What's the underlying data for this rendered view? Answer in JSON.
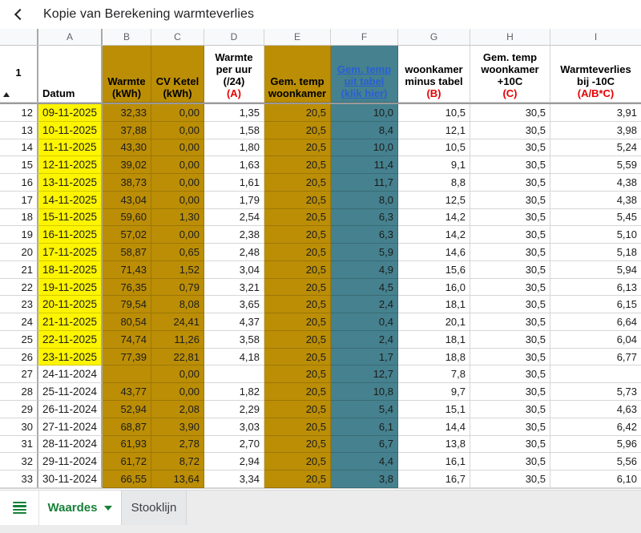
{
  "app": {
    "title": "Kopie van Berekening warmteverlies"
  },
  "colors": {
    "gold": "#bb8e06",
    "teal": "#45818e",
    "yellow": "#fdf400",
    "red": "#e60000",
    "link": "#2a5fd3",
    "green": "#188038"
  },
  "sheet": {
    "column_letters": [
      "A",
      "B",
      "C",
      "D",
      "E",
      "F",
      "G",
      "H",
      "I"
    ],
    "header_row_num": "1",
    "headers": [
      {
        "col": "A",
        "text": "Datum",
        "red": "",
        "bg": "white",
        "align": "left",
        "link": false
      },
      {
        "col": "B",
        "text": "Warmte\n(kWh)",
        "red": "",
        "bg": "gold",
        "align": "center",
        "link": false
      },
      {
        "col": "C",
        "text": "CV Ketel\n(kWh)",
        "red": "",
        "bg": "gold",
        "align": "center",
        "link": false
      },
      {
        "col": "D",
        "text": "Warmte\nper uur\n(/24)",
        "red": "(A)",
        "bg": "white",
        "align": "center",
        "link": false
      },
      {
        "col": "E",
        "text": "Gem. temp\nwoonkamer",
        "red": "",
        "bg": "gold",
        "align": "center",
        "link": false
      },
      {
        "col": "F",
        "text": "Gem. temp\nuit tabel\n(klik hier)",
        "red": "",
        "bg": "teal",
        "align": "center",
        "link": true
      },
      {
        "col": "G",
        "text": "woonkamer\nminus tabel",
        "red": "(B)",
        "bg": "white",
        "align": "center",
        "link": false
      },
      {
        "col": "H",
        "text": "Gem. temp\nwoonkamer\n+10C",
        "red": "(C)",
        "bg": "white",
        "align": "center",
        "link": false
      },
      {
        "col": "I",
        "text": "Warmteverlies\nbij -10C",
        "red": "(A/B*C)",
        "bg": "white",
        "align": "center",
        "link": false
      }
    ],
    "column_bg": [
      "date",
      "gold",
      "gold",
      "white",
      "gold",
      "teal",
      "white",
      "white",
      "white"
    ],
    "rows": [
      {
        "num": "12",
        "highlight": true,
        "cells": [
          "09-11-2025",
          "32,33",
          "0,00",
          "1,35",
          "20,5",
          "10,0",
          "10,5",
          "30,5",
          "3,91"
        ]
      },
      {
        "num": "13",
        "highlight": true,
        "cells": [
          "10-11-2025",
          "37,88",
          "0,00",
          "1,58",
          "20,5",
          "8,4",
          "12,1",
          "30,5",
          "3,98"
        ]
      },
      {
        "num": "14",
        "highlight": true,
        "cells": [
          "11-11-2025",
          "43,30",
          "0,00",
          "1,80",
          "20,5",
          "10,0",
          "10,5",
          "30,5",
          "5,24"
        ]
      },
      {
        "num": "15",
        "highlight": true,
        "cells": [
          "12-11-2025",
          "39,02",
          "0,00",
          "1,63",
          "20,5",
          "11,4",
          "9,1",
          "30,5",
          "5,59"
        ]
      },
      {
        "num": "16",
        "highlight": true,
        "cells": [
          "13-11-2025",
          "38,73",
          "0,00",
          "1,61",
          "20,5",
          "11,7",
          "8,8",
          "30,5",
          "4,38"
        ]
      },
      {
        "num": "17",
        "highlight": true,
        "cells": [
          "14-11-2025",
          "43,04",
          "0,00",
          "1,79",
          "20,5",
          "8,0",
          "12,5",
          "30,5",
          "4,38"
        ]
      },
      {
        "num": "18",
        "highlight": true,
        "cells": [
          "15-11-2025",
          "59,60",
          "1,30",
          "2,54",
          "20,5",
          "6,3",
          "14,2",
          "30,5",
          "5,45"
        ]
      },
      {
        "num": "19",
        "highlight": true,
        "cells": [
          "16-11-2025",
          "57,02",
          "0,00",
          "2,38",
          "20,5",
          "6,3",
          "14,2",
          "30,5",
          "5,10"
        ]
      },
      {
        "num": "20",
        "highlight": true,
        "cells": [
          "17-11-2025",
          "58,87",
          "0,65",
          "2,48",
          "20,5",
          "5,9",
          "14,6",
          "30,5",
          "5,18"
        ]
      },
      {
        "num": "21",
        "highlight": true,
        "cells": [
          "18-11-2025",
          "71,43",
          "1,52",
          "3,04",
          "20,5",
          "4,9",
          "15,6",
          "30,5",
          "5,94"
        ]
      },
      {
        "num": "22",
        "highlight": true,
        "cells": [
          "19-11-2025",
          "76,35",
          "0,79",
          "3,21",
          "20,5",
          "4,5",
          "16,0",
          "30,5",
          "6,13"
        ]
      },
      {
        "num": "23",
        "highlight": true,
        "cells": [
          "20-11-2025",
          "79,54",
          "8,08",
          "3,65",
          "20,5",
          "2,4",
          "18,1",
          "30,5",
          "6,15"
        ]
      },
      {
        "num": "24",
        "highlight": true,
        "cells": [
          "21-11-2025",
          "80,54",
          "24,41",
          "4,37",
          "20,5",
          "0,4",
          "20,1",
          "30,5",
          "6,64"
        ]
      },
      {
        "num": "25",
        "highlight": true,
        "cells": [
          "22-11-2025",
          "74,74",
          "11,26",
          "3,58",
          "20,5",
          "2,4",
          "18,1",
          "30,5",
          "6,04"
        ]
      },
      {
        "num": "26",
        "highlight": true,
        "cells": [
          "23-11-2025",
          "77,39",
          "22,81",
          "4,18",
          "20,5",
          "1,7",
          "18,8",
          "30,5",
          "6,77"
        ]
      },
      {
        "num": "27",
        "highlight": false,
        "cells": [
          "24-11-2024",
          "",
          "0,00",
          "",
          "20,5",
          "12,7",
          "7,8",
          "30,5",
          ""
        ]
      },
      {
        "num": "28",
        "highlight": false,
        "cells": [
          "25-11-2024",
          "43,77",
          "0,00",
          "1,82",
          "20,5",
          "10,8",
          "9,7",
          "30,5",
          "5,73"
        ]
      },
      {
        "num": "29",
        "highlight": false,
        "cells": [
          "26-11-2024",
          "52,94",
          "2,08",
          "2,29",
          "20,5",
          "5,4",
          "15,1",
          "30,5",
          "4,63"
        ]
      },
      {
        "num": "30",
        "highlight": false,
        "cells": [
          "27-11-2024",
          "68,87",
          "3,90",
          "3,03",
          "20,5",
          "6,1",
          "14,4",
          "30,5",
          "6,42"
        ]
      },
      {
        "num": "31",
        "highlight": false,
        "cells": [
          "28-11-2024",
          "61,93",
          "2,78",
          "2,70",
          "20,5",
          "6,7",
          "13,8",
          "30,5",
          "5,96"
        ]
      },
      {
        "num": "32",
        "highlight": false,
        "cells": [
          "29-11-2024",
          "61,72",
          "8,72",
          "2,94",
          "20,5",
          "4,4",
          "16,1",
          "30,5",
          "5,56"
        ]
      },
      {
        "num": "33",
        "highlight": false,
        "cells": [
          "30-11-2024",
          "66,55",
          "13,64",
          "3,34",
          "20,5",
          "3,8",
          "16,7",
          "30,5",
          "6,10"
        ]
      }
    ]
  },
  "tabs": {
    "items": [
      {
        "label": "Waardes",
        "active": true
      },
      {
        "label": "Stooklijn",
        "active": false
      }
    ]
  }
}
